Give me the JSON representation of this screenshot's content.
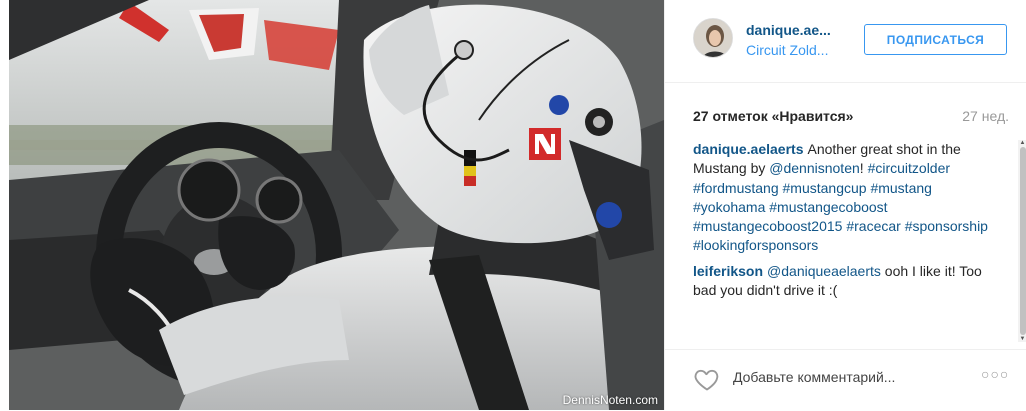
{
  "post": {
    "watermark": "DennisNoten.com"
  },
  "header": {
    "username": "danique.ae...",
    "location": "Circuit Zold...",
    "follow_label": "ПОДПИСАТЬСЯ"
  },
  "stats": {
    "likes": "27 отметок «Нравится»",
    "time": "27 нед."
  },
  "comments": [
    {
      "user": "danique.aelaerts",
      "text": "Another great shot in the Mustang by",
      "mention": "@dennisnoten",
      "after": "!",
      "tags": "#circuitzolder #fordmustang #mustangcup #mustang #yokohama #mustangecoboost #mustangecoboost2015 #racecar #sponsorship #lookingforsponsors"
    },
    {
      "user": "leiferikson",
      "mention": "@daniqueaelaerts",
      "text": "ooh I like it! Too bad you didn't drive it :("
    }
  ],
  "footer": {
    "comment_placeholder": "Добавьте комментарий...",
    "more_label": "○○○",
    "like_icon": "heart-icon"
  },
  "colors": {
    "link": "#125688",
    "accent": "#3897f0",
    "muted": "#999999"
  }
}
